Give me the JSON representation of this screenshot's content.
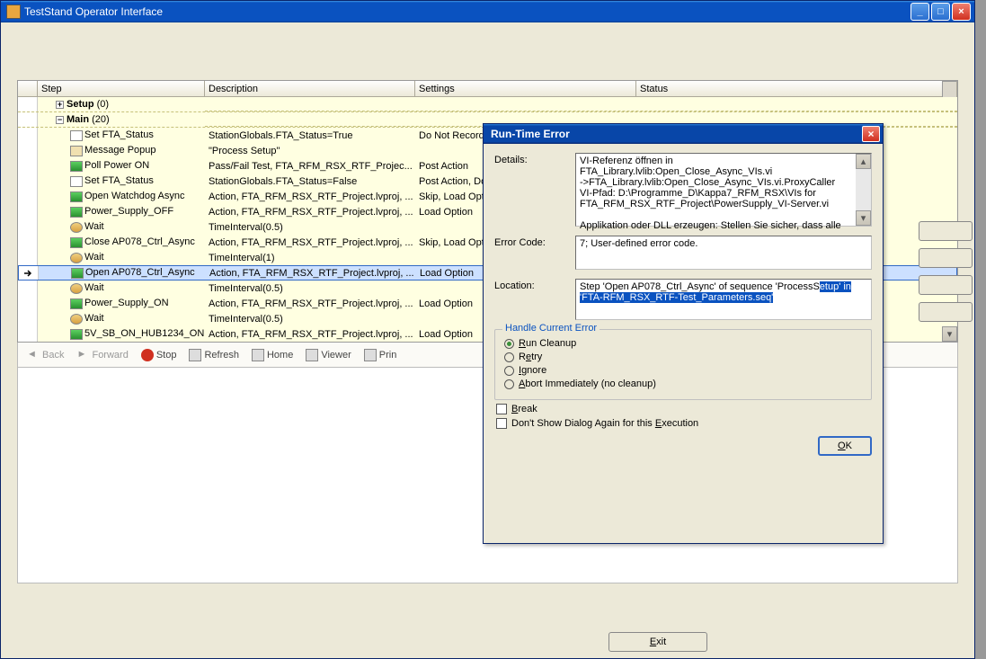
{
  "mainWindow": {
    "title": "TestStand Operator Interface"
  },
  "grid": {
    "headers": {
      "step": "Step",
      "description": "Description",
      "settings": "Settings",
      "status": "Status"
    },
    "groups": [
      {
        "name": "Setup",
        "count": "(0)",
        "expanded": false
      },
      {
        "name": "Main",
        "count": "(20)",
        "expanded": true
      }
    ],
    "rows": [
      {
        "icon": "fx",
        "name": "Set FTA_Status",
        "desc": "StationGlobals.FTA_Status=True",
        "set": "Do Not Record Re"
      },
      {
        "icon": "tag",
        "name": "Message Popup",
        "desc": "\"Process Setup\"",
        "set": ""
      },
      {
        "icon": "play",
        "name": "Poll Power ON",
        "desc": "Pass/Fail Test,  FTA_RFM_RSX_RTF_Projec...",
        "set": "Post Action"
      },
      {
        "icon": "fx",
        "name": "Set FTA_Status",
        "desc": "StationGlobals.FTA_Status=False",
        "set": "Post Action, Do N"
      },
      {
        "icon": "play",
        "name": "Open Watchdog Async",
        "desc": "Action,  FTA_RFM_RSX_RTF_Project.lvproj, ...",
        "set": "Skip, Load Option"
      },
      {
        "icon": "play",
        "name": "Power_Supply_OFF",
        "desc": "Action,  FTA_RFM_RSX_RTF_Project.lvproj, ...",
        "set": "Load Option"
      },
      {
        "icon": "wait",
        "name": "Wait",
        "desc": "TimeInterval(0.5)",
        "set": ""
      },
      {
        "icon": "play",
        "name": "Close AP078_Ctrl_Async",
        "desc": "Action,  FTA_RFM_RSX_RTF_Project.lvproj, ...",
        "set": "Skip, Load Option"
      },
      {
        "icon": "wait",
        "name": "Wait",
        "desc": "TimeInterval(1)",
        "set": ""
      },
      {
        "icon": "play",
        "name": "Open AP078_Ctrl_Async",
        "desc": "Action,  FTA_RFM_RSX_RTF_Project.lvproj, ...",
        "set": "Load Option",
        "selected": true,
        "pointer": true
      },
      {
        "icon": "wait",
        "name": "Wait",
        "desc": "TimeInterval(0.5)",
        "set": ""
      },
      {
        "icon": "play",
        "name": "Power_Supply_ON",
        "desc": "Action,  FTA_RFM_RSX_RTF_Project.lvproj, ...",
        "set": "Load Option"
      },
      {
        "icon": "wait",
        "name": "Wait",
        "desc": "TimeInterval(0.5)",
        "set": ""
      },
      {
        "icon": "play",
        "name": "5V_SB_ON_HUB1234_ON",
        "desc": "Action,  FTA_RFM_RSX_RTF_Project.lvproj, ...",
        "set": "Load Option"
      }
    ]
  },
  "toolbar": {
    "back": "Back",
    "forward": "Forward",
    "stop": "Stop",
    "refresh": "Refresh",
    "home": "Home",
    "viewer": "Viewer",
    "print": "Prin"
  },
  "exitBtn": "Exit",
  "dialog": {
    "title": "Run-Time Error",
    "labels": {
      "details": "Details:",
      "errorCode": "Error Code:",
      "location": "Location:"
    },
    "details": "VI-Referenz öffnen in FTA_Library.lvlib:Open_Close_Async_VIs.vi\n->FTA_Library.lvlib:Open_Close_Async_VIs.vi.ProxyCaller\nVI-Pfad: D:\\Programme_D\\Kappa7_RFM_RSX\\VIs for FTA_RFM_RSX_RTF_Project\\PowerSupply_VI-Server.vi\n\nApplikation oder DLL erzeugen: Stellen Sie sicher, dass alle",
    "errorCode": "7; User-defined error code.",
    "location": {
      "plain": "Step 'Open AP078_Ctrl_Async' of sequence 'ProcessS",
      "hl": "etup' in 'FTA-RFM_RSX_RTF-Test_Parameters.seq'"
    },
    "handleTitle": "Handle Current Error",
    "radios": {
      "cleanup": "Run Cleanup",
      "retry": "Retry",
      "ignore": "Ignore",
      "abort": "Abort Immediately (no cleanup)"
    },
    "checks": {
      "break": "Break",
      "dontshow": "Don't Show Dialog Again for this Execution"
    },
    "ok": "OK"
  }
}
